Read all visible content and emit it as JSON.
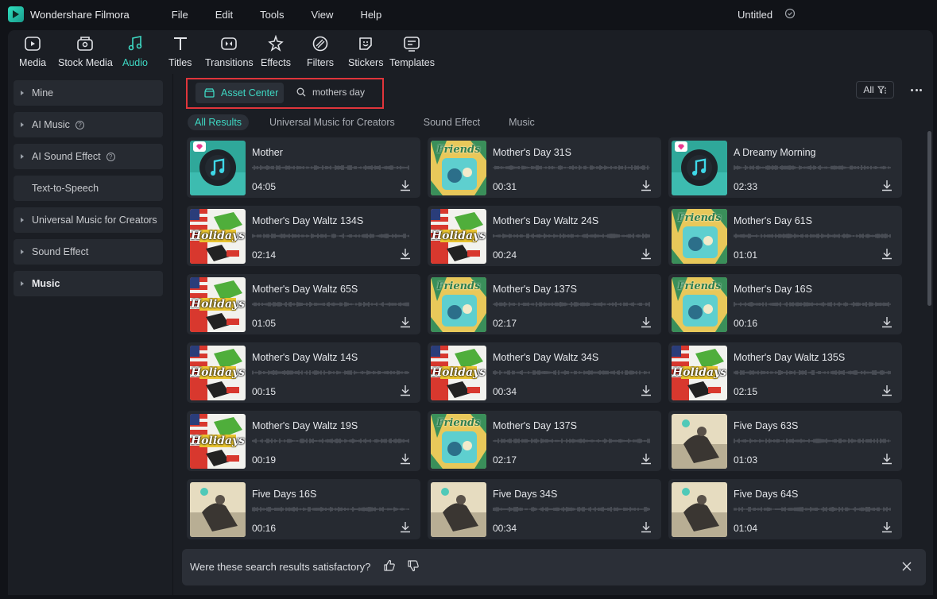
{
  "app": {
    "name": "Wondershare Filmora",
    "doc_title": "Untitled"
  },
  "menu": [
    "File",
    "Edit",
    "Tools",
    "View",
    "Help"
  ],
  "toolbar": [
    {
      "label": "Media",
      "icon": "media-icon"
    },
    {
      "label": "Stock Media",
      "icon": "stock-media-icon"
    },
    {
      "label": "Audio",
      "icon": "audio-icon",
      "active": true
    },
    {
      "label": "Titles",
      "icon": "titles-icon"
    },
    {
      "label": "Transitions",
      "icon": "transitions-icon"
    },
    {
      "label": "Effects",
      "icon": "effects-icon"
    },
    {
      "label": "Filters",
      "icon": "filters-icon"
    },
    {
      "label": "Stickers",
      "icon": "stickers-icon"
    },
    {
      "label": "Templates",
      "icon": "templates-icon"
    }
  ],
  "sidebar": [
    {
      "label": "Mine"
    },
    {
      "label": "AI Music",
      "help": true
    },
    {
      "label": "AI Sound Effect",
      "help": true
    },
    {
      "label": "Text-to-Speech"
    },
    {
      "label": "Universal Music for Creators"
    },
    {
      "label": "Sound Effect"
    },
    {
      "label": "Music",
      "selected": true
    }
  ],
  "search": {
    "asset_center": "Asset Center",
    "query": "mothers day"
  },
  "filter": {
    "label": "All"
  },
  "tabs": [
    "All Results",
    "Universal Music for Creators",
    "Sound Effect",
    "Music"
  ],
  "results": [
    {
      "title": "Mother",
      "duration": "04:05",
      "thumb": "music-disc",
      "premium": true
    },
    {
      "title": "Mother's Day 31S",
      "duration": "00:31",
      "thumb": "friends"
    },
    {
      "title": "A Dreamy Morning",
      "duration": "02:33",
      "thumb": "music-disc",
      "premium": true
    },
    {
      "title": "Mother's Day Waltz 134S",
      "duration": "02:14",
      "thumb": "holidays"
    },
    {
      "title": "Mother's Day Waltz 24S",
      "duration": "00:24",
      "thumb": "holidays"
    },
    {
      "title": "Mother's Day 61S",
      "duration": "01:01",
      "thumb": "friends"
    },
    {
      "title": "Mother's Day Waltz 65S",
      "duration": "01:05",
      "thumb": "holidays"
    },
    {
      "title": "Mother's Day 137S",
      "duration": "02:17",
      "thumb": "friends"
    },
    {
      "title": "Mother's Day 16S",
      "duration": "00:16",
      "thumb": "friends"
    },
    {
      "title": "Mother's Day Waltz 14S",
      "duration": "00:15",
      "thumb": "holidays"
    },
    {
      "title": "Mother's Day Waltz 34S",
      "duration": "00:34",
      "thumb": "holidays"
    },
    {
      "title": "Mother's Day Waltz 135S",
      "duration": "02:15",
      "thumb": "holidays"
    },
    {
      "title": "Mother's Day Waltz 19S",
      "duration": "00:19",
      "thumb": "holidays"
    },
    {
      "title": "Mother's Day 137S",
      "duration": "02:17",
      "thumb": "friends"
    },
    {
      "title": "Five Days 63S",
      "duration": "01:03",
      "thumb": "sepia"
    },
    {
      "title": "Five Days 16S",
      "duration": "00:16",
      "thumb": "sepia"
    },
    {
      "title": "Five Days 34S",
      "duration": "00:34",
      "thumb": "sepia"
    },
    {
      "title": "Five Days 64S",
      "duration": "01:04",
      "thumb": "sepia"
    }
  ],
  "thumb_text": {
    "friends": "Friends",
    "holidays": "Holidays"
  },
  "feedback": {
    "question": "Were these search results satisfactory?"
  },
  "colors": {
    "accent": "#3ed8c3",
    "highlight_border": "#e0353b",
    "premium": "#e8388f"
  }
}
